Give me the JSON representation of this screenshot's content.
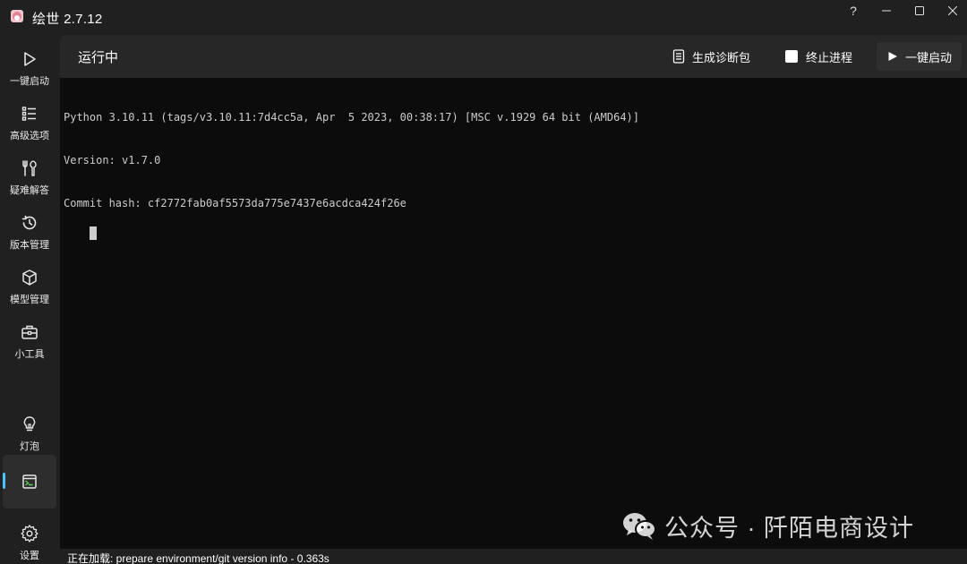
{
  "window": {
    "title": "绘世 2.7.12",
    "help_glyph": "?",
    "min_glyph": "—",
    "max_glyph": "☐",
    "close_glyph": "✕"
  },
  "sidebar": {
    "items": [
      {
        "label": "一键启动",
        "icon": "play-icon"
      },
      {
        "label": "高级选项",
        "icon": "list-icon"
      },
      {
        "label": "疑难解答",
        "icon": "tools-icon"
      },
      {
        "label": "版本管理",
        "icon": "history-icon"
      },
      {
        "label": "模型管理",
        "icon": "cube-icon"
      },
      {
        "label": "小工具",
        "icon": "toolbox-icon"
      }
    ],
    "bottom_items": [
      {
        "label": "灯泡",
        "icon": "lightbulb-icon"
      },
      {
        "label": "",
        "icon": "terminal-icon",
        "active": true
      },
      {
        "label": "设置",
        "icon": "gear-icon"
      }
    ],
    "accent_color": "#4cc2ff"
  },
  "main": {
    "title": "运行中",
    "buttons": {
      "diagnose": "生成诊断包",
      "stop": "终止进程",
      "start": "一键启动"
    },
    "console_lines": [
      "Python 3.10.11 (tags/v3.10.11:7d4cc5a, Apr  5 2023, 00:38:17) [MSC v.1929 64 bit (AMD64)]",
      "Version: v1.7.0",
      "Commit hash: cf2772fab0af5573da775e7437e6acdca424f26e"
    ]
  },
  "watermark": {
    "text": "公众号 · 阡陌电商设计"
  },
  "status": {
    "text": "正在加载: prepare environment/git version info - 0.363s"
  }
}
